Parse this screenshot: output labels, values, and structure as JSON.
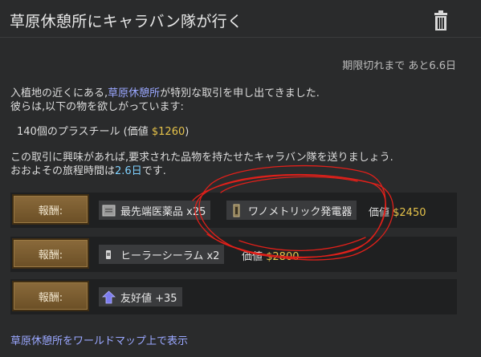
{
  "title": "草原休憩所にキャラバン隊が行く",
  "expiry": "期限切れまで あと6.6日",
  "intro": {
    "line1_prefix": "入植地の近くにある,",
    "line1_link": "草原休憩所",
    "line1_suffix": "が特別な取引を申し出てきました.",
    "line2": "彼らは,以下の物を欲しがっています:"
  },
  "request": {
    "prefix": "140個のプラスチール (価値 ",
    "value": "$1260",
    "suffix": ")"
  },
  "caravan": {
    "line1": "この取引に興味があれば,要求された品物を持たせたキャラバン隊を送りましょう.",
    "line2_prefix": "おおよその旅程時間は",
    "line2_days": "2.6日",
    "line2_suffix": "です."
  },
  "rewards": [
    {
      "button": "報酬:",
      "items": [
        {
          "label": "最先端医薬品 x25",
          "icon": "medicine-icon"
        },
        {
          "label": "ワノメトリック発電器",
          "icon": "generator-icon"
        }
      ],
      "value_label": "価値 ",
      "value": "$2450"
    },
    {
      "button": "報酬:",
      "items": [
        {
          "label": "ヒーラーシーラム x2",
          "icon": "serum-icon"
        }
      ],
      "value_label": "価値 ",
      "value": "$2800"
    },
    {
      "button": "報酬:",
      "items": [
        {
          "label": "友好値 +35",
          "icon": "goodwill-icon"
        }
      ]
    }
  ],
  "bottom_link": "草原休憩所をワールドマップ上で表示",
  "colors": {
    "background": "#2a2b2c",
    "row": "#1f2021",
    "link": "#9aa7ff",
    "money": "#e6c34a",
    "days": "#7fd1ff",
    "button": "#7a5c30",
    "scribble": "#e0201a"
  }
}
